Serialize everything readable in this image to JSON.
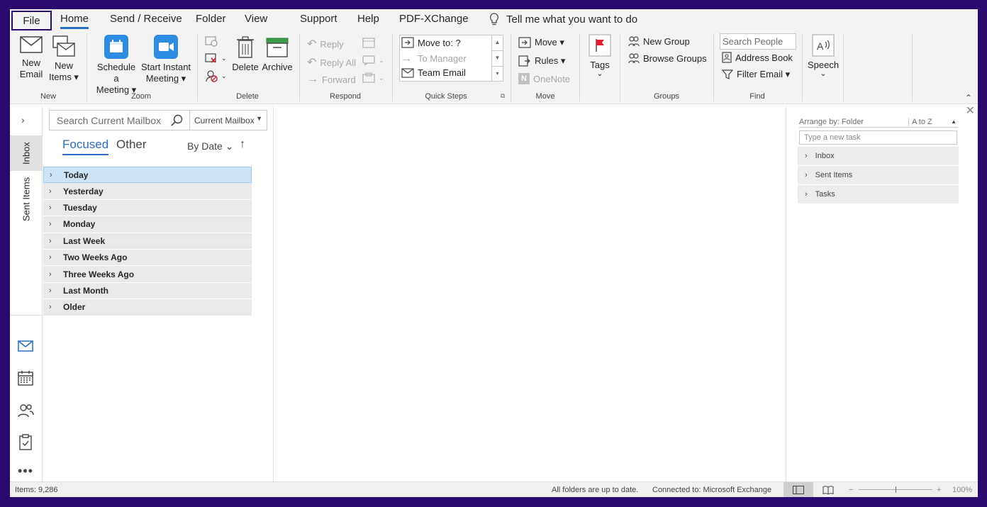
{
  "menu": {
    "tabs": [
      "File",
      "Home",
      "Send / Receive",
      "Folder",
      "View",
      "Support",
      "Help",
      "PDF-XChange"
    ],
    "tell_me": "Tell me what you want to do"
  },
  "ribbon": {
    "new": {
      "new_email_1": "New",
      "new_email_2": "Email",
      "new_items_1": "New",
      "new_items_2": "Items ▾",
      "label": "New"
    },
    "zoom": {
      "schedule_1": "Schedule a",
      "schedule_2": "Meeting ▾",
      "instant_1": "Start Instant",
      "instant_2": "Meeting ▾",
      "label": "Zoom"
    },
    "delete": {
      "delete": "Delete",
      "archive": "Archive",
      "label": "Delete"
    },
    "respond": {
      "reply": "Reply",
      "reply_all": "Reply All",
      "forward": "Forward",
      "label": "Respond"
    },
    "quick_steps": {
      "move_to": "Move to: ?",
      "to_manager": "To Manager",
      "team_email": "Team Email",
      "label": "Quick Steps"
    },
    "move": {
      "move": "Move ▾",
      "rules": "Rules ▾",
      "onenote": "OneNote",
      "label": "Move"
    },
    "tags": {
      "tags": "Tags",
      "caret": "⌄"
    },
    "groups": {
      "new_group": "New Group",
      "browse_groups": "Browse Groups",
      "label": "Groups"
    },
    "find": {
      "search_people": "Search People",
      "address_book": "Address Book",
      "filter_email": "Filter Email ▾",
      "label": "Find"
    },
    "speech": {
      "speech": "Speech",
      "caret": "⌄"
    }
  },
  "nav": {
    "inbox": "Inbox",
    "sent_items": "Sent Items"
  },
  "maillist": {
    "search_placeholder": "Search Current Mailbox",
    "scope": "Current Mailbox",
    "tab_focused": "Focused",
    "tab_other": "Other",
    "sort": "By Date ⌄",
    "sort_arrow": "↑",
    "groups": [
      "Today",
      "Yesterday",
      "Tuesday",
      "Monday",
      "Last Week",
      "Two Weeks Ago",
      "Three Weeks Ago",
      "Last Month",
      "Older"
    ]
  },
  "todo": {
    "arrange_by": "Arrange by: Folder",
    "sort_order": "A to Z",
    "new_task_placeholder": "Type a new task",
    "folders": [
      "Inbox",
      "Sent Items",
      "Tasks"
    ]
  },
  "status": {
    "items": "Items: 9,286",
    "sync": "All folders are up to date.",
    "connection": "Connected to: Microsoft Exchange",
    "zoom_minus": "−",
    "zoom_plus": "+",
    "zoom_level": "100%"
  },
  "colors": {
    "accent": "#2a6dc4",
    "frame": "#2a0a6e",
    "zoom_blue": "#2d8ce2"
  }
}
